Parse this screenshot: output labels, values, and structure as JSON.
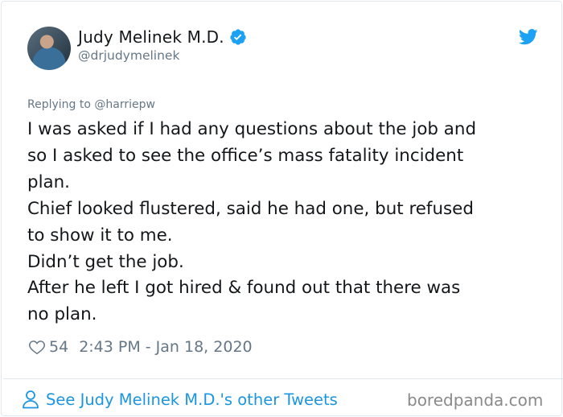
{
  "tweet": {
    "author": {
      "display_name": "Judy Melinek M.D.",
      "handle": "@drjudymelinek",
      "verified": true,
      "avatar_icon": "avatar-photo"
    },
    "reply_to": "Replying to @harriepw",
    "text_lines": [
      "I was asked if I had any questions about the job and",
      "so I asked to see the office’s mass fatality incident",
      "plan.",
      "Chief looked flustered, said he had one, but refused",
      "to show it to me.",
      "Didn’t get the job.",
      "After he left I got hired & found out that there was",
      "no plan."
    ],
    "likes": "54",
    "timestamp": "2:43 PM - Jan 18, 2020",
    "more_tweets_label": "See Judy Melinek M.D.'s other Tweets"
  },
  "watermark": "boredpanda.com",
  "colors": {
    "twitter_blue": "#1da1f2",
    "link_blue": "#1b95e0",
    "secondary_text": "#657786",
    "primary_text": "#14171a",
    "border": "#e1e8ed"
  },
  "icons": [
    "verified-icon",
    "twitter-bird-icon",
    "heart-icon",
    "person-icon"
  ]
}
